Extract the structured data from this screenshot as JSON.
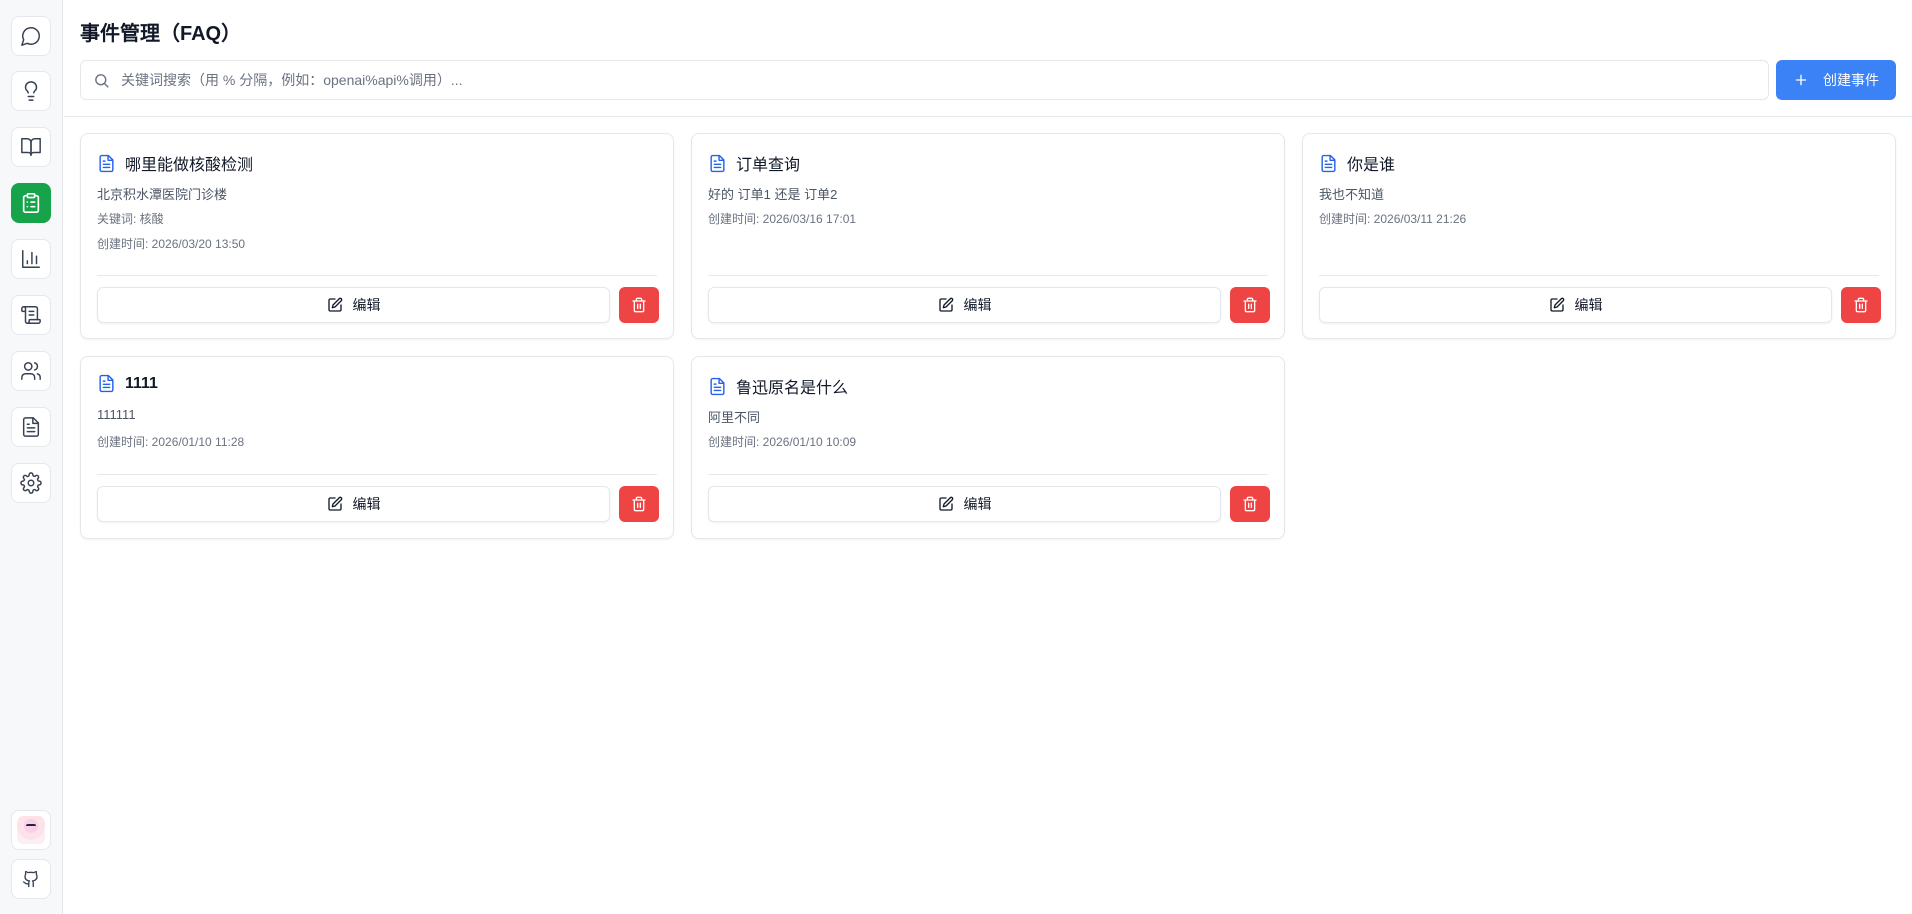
{
  "header": {
    "title": "事件管理（FAQ）",
    "search_placeholder": "关键词搜索（用 % 分隔，例如：openai%api%调用）...",
    "create_label": "创建事件"
  },
  "sidebar": {
    "items": [
      {
        "icon": "chat-bubble-icon"
      },
      {
        "icon": "lightbulb-icon"
      },
      {
        "icon": "book-open-icon"
      },
      {
        "icon": "clipboard-list-icon",
        "active": true
      },
      {
        "icon": "bar-chart-icon"
      },
      {
        "icon": "scroll-icon"
      },
      {
        "icon": "users-icon"
      },
      {
        "icon": "document-icon"
      },
      {
        "icon": "gear-icon"
      }
    ],
    "bottom": [
      {
        "icon": "avatar"
      },
      {
        "icon": "github-icon"
      }
    ]
  },
  "cards": [
    {
      "title": "哪里能做核酸检测",
      "answer": "北京积水潭医院门诊楼",
      "keywords": "关键词: 核酸",
      "created": "创建时间: 2026/03/20 13:50",
      "edit_label": "编辑"
    },
    {
      "title": "订单查询",
      "answer": "好的 订单1 还是 订单2",
      "keywords": "",
      "created": "创建时间: 2026/03/16 17:01",
      "edit_label": "编辑"
    },
    {
      "title": "你是谁",
      "answer": "我也不知道",
      "keywords": "",
      "created": "创建时间: 2026/03/11 21:26",
      "edit_label": "编辑"
    },
    {
      "title": "1111",
      "answer": "111111",
      "keywords": "",
      "created": "创建时间: 2026/01/10 11:28",
      "edit_label": "编辑"
    },
    {
      "title": "鲁迅原名是什么",
      "answer": "阿里不同",
      "keywords": "",
      "created": "创建时间: 2026/01/10 10:09",
      "edit_label": "编辑"
    }
  ],
  "colors": {
    "accent": "#3b82f6",
    "active_nav": "#16a34a",
    "danger": "#ef4444",
    "doc_icon": "#2563eb"
  }
}
